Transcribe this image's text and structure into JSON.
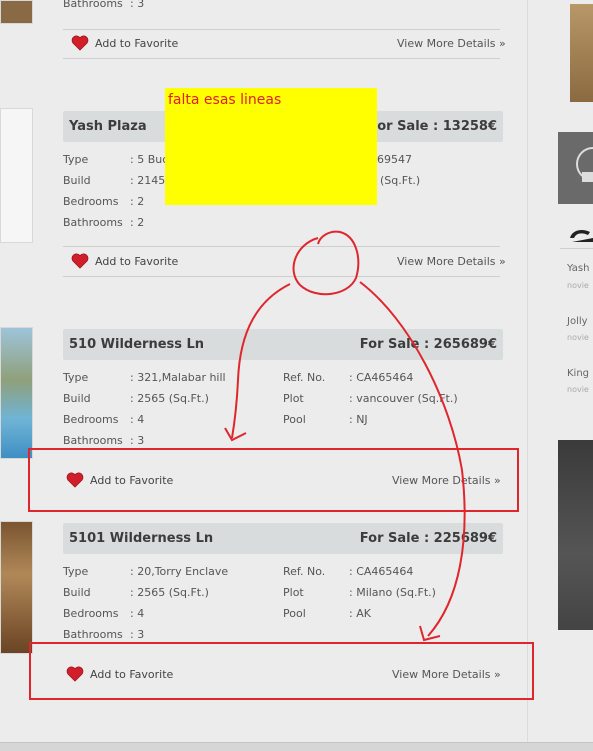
{
  "top_listing": {
    "bath_label": "Bathrooms",
    "bath_value": ": 3",
    "fav_label": "Add to Favorite",
    "more_label": "View More Details »"
  },
  "listings": [
    {
      "name": "Yash Plaza",
      "price": "For Sale : 13258€",
      "left": [
        {
          "label": "Type",
          "value": ": 5 Buck"
        },
        {
          "label": "Build",
          "value": ": 2145 ("
        },
        {
          "label": "Bedrooms",
          "value": ": 2"
        },
        {
          "label": "Bathrooms",
          "value": ": 2"
        }
      ],
      "right_partial": [
        "69547",
        "(Sq.Ft.)"
      ],
      "fav_label": "Add to Favorite",
      "more_label": "View More Details »"
    },
    {
      "name": "510 Wilderness Ln",
      "price": "For Sale : 265689€",
      "left": [
        {
          "label": "Type",
          "value": ": 321,Malabar hill"
        },
        {
          "label": "Build",
          "value": ": 2565 (Sq.Ft.)"
        },
        {
          "label": "Bedrooms",
          "value": ": 4"
        },
        {
          "label": "Bathrooms",
          "value": ": 3"
        }
      ],
      "right": [
        {
          "label": "Ref. No.",
          "value": ": CA465464"
        },
        {
          "label": "Plot",
          "value": ": vancouver (Sq.Ft.)"
        },
        {
          "label": "Pool",
          "value": ": NJ"
        }
      ],
      "fav_label": "Add to Favorite",
      "more_label": "View More Details »"
    },
    {
      "name": "5101 Wilderness Ln",
      "price": "For Sale : 225689€",
      "left": [
        {
          "label": "Type",
          "value": ": 20,Torry Enclave"
        },
        {
          "label": "Build",
          "value": ": 2565 (Sq.Ft.)"
        },
        {
          "label": "Bedrooms",
          "value": ": 4"
        },
        {
          "label": "Bathrooms",
          "value": ": 3"
        }
      ],
      "right": [
        {
          "label": "Ref. No.",
          "value": ": CA465464"
        },
        {
          "label": "Plot",
          "value": ": Milano (Sq.Ft.)"
        },
        {
          "label": "Pool",
          "value": ": AK"
        }
      ],
      "fav_label": "Add to Favorite",
      "more_label": "View More Details »"
    }
  ],
  "annotation": {
    "note_text": "falta esas lineas",
    "note_bg": "#ffff00",
    "note_color": "#e02020",
    "markup_color": "#e0262d"
  },
  "sidebar": {
    "items": [
      {
        "title": "Yash",
        "sub": "novie"
      },
      {
        "title": "Jolly",
        "sub": "novie"
      },
      {
        "title": "King",
        "sub": "novie"
      }
    ]
  }
}
